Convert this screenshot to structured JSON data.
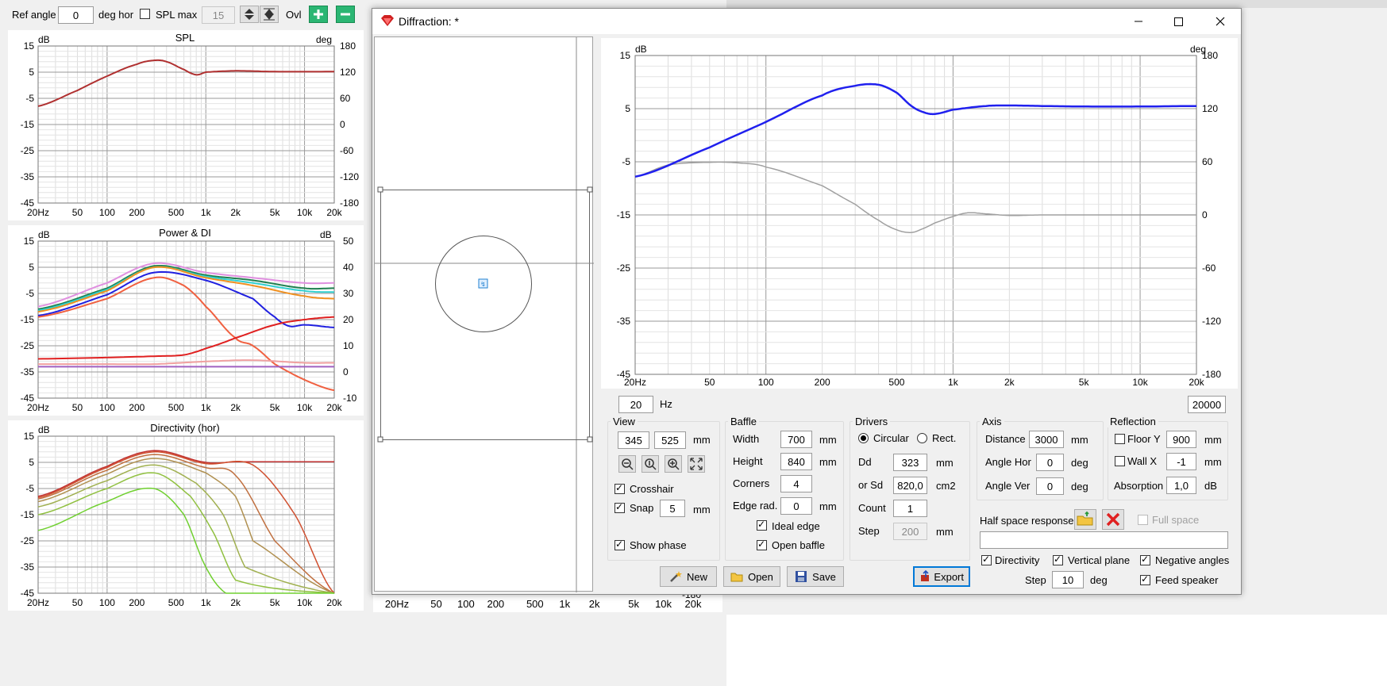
{
  "toolbar": {
    "ref_angle_label": "Ref angle",
    "ref_angle_value": "0",
    "deg_hor_label": "deg hor",
    "spl_max_label": "SPL max",
    "spl_max_value": "15",
    "ovl_label": "Ovl"
  },
  "charts": {
    "spl": {
      "title": "SPL",
      "left_unit": "dB",
      "right_unit": "deg",
      "left_ticks": [
        "15",
        "5",
        "-5",
        "-15",
        "-25",
        "-35",
        "-45"
      ],
      "right_ticks": [
        "180",
        "120",
        "60",
        "0",
        "-60",
        "-120",
        "-180"
      ]
    },
    "power": {
      "title": "Power & DI",
      "left_unit": "dB",
      "right_unit": "dB",
      "left_ticks": [
        "15",
        "5",
        "-5",
        "-15",
        "-25",
        "-35",
        "-45"
      ],
      "right_ticks": [
        "50",
        "40",
        "30",
        "20",
        "10",
        "0",
        "-10"
      ]
    },
    "directivity": {
      "title": "Directivity (hor)",
      "left_unit": "dB",
      "left_ticks": [
        "15",
        "5",
        "-5",
        "-15",
        "-25",
        "-35",
        "-45"
      ]
    },
    "x_ticks": [
      "20Hz",
      "50",
      "100",
      "200",
      "500",
      "1k",
      "2k",
      "5k",
      "10k",
      "20k"
    ],
    "bottom_x_ticks": [
      "20Hz",
      "50",
      "100",
      "200",
      "500",
      "1k",
      "2k",
      "5k",
      "10k",
      "20k"
    ],
    "bottom_right_tick": "-180"
  },
  "chart_data": [
    {
      "type": "line",
      "title": "SPL",
      "x_scale": "log",
      "xlim": [
        20,
        20000
      ],
      "ylim": [
        -45,
        15
      ],
      "y2lim": [
        -180,
        180
      ],
      "series": [
        {
          "color": "#b03030",
          "x": [
            20,
            50,
            100,
            200,
            300,
            400,
            600,
            800,
            1000,
            2000,
            5000,
            20000
          ],
          "y": [
            -8,
            -2,
            3.5,
            8,
            9.5,
            9,
            6,
            4,
            5,
            5.5,
            5.2,
            5.2
          ]
        }
      ]
    },
    {
      "type": "line",
      "title": "Power & DI",
      "x_scale": "log",
      "xlim": [
        20,
        20000
      ],
      "ylim": [
        -45,
        15
      ],
      "y2lim": [
        -10,
        50
      ],
      "series": [
        {
          "color": "#e090e0",
          "x": [
            20,
            100,
            300,
            1000,
            3000,
            10000,
            20000
          ],
          "y": [
            -10,
            -1,
            6.5,
            3,
            1,
            -1,
            -1
          ]
        },
        {
          "color": "#208050",
          "x": [
            20,
            100,
            300,
            1000,
            3000,
            10000,
            20000
          ],
          "y": [
            -11,
            -3,
            5.5,
            2,
            0,
            -3,
            -3
          ]
        },
        {
          "color": "#30d0d0",
          "x": [
            20,
            100,
            300,
            1000,
            3000,
            10000,
            20000
          ],
          "y": [
            -11.5,
            -3.5,
            5,
            1.5,
            -1,
            -4,
            -4.5
          ]
        },
        {
          "color": "#f09020",
          "x": [
            20,
            100,
            300,
            1000,
            3000,
            10000,
            20000
          ],
          "y": [
            -12,
            -4,
            5,
            1,
            -2,
            -6,
            -7
          ]
        },
        {
          "color": "#2020e0",
          "x": [
            20,
            100,
            300,
            1000,
            3000,
            5000,
            7000,
            10000,
            20000
          ],
          "y": [
            -13.5,
            -5.5,
            3,
            0,
            -7,
            -14,
            -17.5,
            -17,
            -18
          ]
        },
        {
          "color": "#f06040",
          "x": [
            20,
            100,
            300,
            600,
            1000,
            2000,
            3000,
            5000,
            10000,
            20000
          ],
          "y": [
            -14,
            -7,
            1,
            -2,
            -10,
            -22,
            -25,
            -32,
            -38,
            -42
          ]
        },
        {
          "color": "#e02020",
          "x": [
            20,
            100,
            300,
            600,
            1000,
            2000,
            5000,
            10000,
            20000
          ],
          "y": [
            -30,
            -29.5,
            -29,
            -28.5,
            -26,
            -22,
            -17,
            -15,
            -14
          ]
        },
        {
          "color": "#f0a0a0",
          "x": [
            20,
            100,
            300,
            1000,
            3000,
            10000,
            20000
          ],
          "y": [
            -32,
            -32,
            -32,
            -31,
            -30.5,
            -31.5,
            -31.5
          ]
        },
        {
          "color": "#a060c0",
          "x": [
            20,
            100,
            300,
            1000,
            3000,
            10000,
            20000
          ],
          "y": [
            -33,
            -33,
            -33,
            -33,
            -33,
            -33,
            -33
          ]
        }
      ]
    },
    {
      "type": "line",
      "title": "Directivity (hor)",
      "x_scale": "log",
      "xlim": [
        20,
        20000
      ],
      "ylim": [
        -45,
        15
      ],
      "series": [
        {
          "color": "#c03030",
          "x": [
            20,
            100,
            300,
            1000,
            2000,
            20000
          ],
          "y": [
            -8,
            3.5,
            9.5,
            5,
            5.2,
            5.2
          ]
        },
        {
          "color": "#d05030",
          "x": [
            20,
            100,
            300,
            1000,
            3000,
            8000,
            20000
          ],
          "y": [
            -8.5,
            3,
            9,
            4.5,
            4,
            -15,
            -45
          ]
        },
        {
          "color": "#c07040",
          "x": [
            20,
            100,
            300,
            1000,
            2000,
            5000,
            20000
          ],
          "y": [
            -9,
            2,
            8,
            3,
            0,
            -25,
            -45
          ]
        },
        {
          "color": "#b09050",
          "x": [
            20,
            100,
            300,
            1000,
            2000,
            3000,
            20000
          ],
          "y": [
            -10,
            0.5,
            6.5,
            1,
            -8,
            -25,
            -45
          ]
        },
        {
          "color": "#a0b050",
          "x": [
            20,
            100,
            300,
            800,
            1500,
            2500,
            20000
          ],
          "y": [
            -12,
            -2,
            4,
            -3,
            -15,
            -35,
            -45
          ]
        },
        {
          "color": "#90c040",
          "x": [
            20,
            100,
            300,
            700,
            1200,
            2000,
            20000
          ],
          "y": [
            -15,
            -5,
            1,
            -8,
            -22,
            -40,
            -45
          ]
        },
        {
          "color": "#70d030",
          "x": [
            20,
            100,
            300,
            600,
            1000,
            1600,
            20000
          ],
          "y": [
            -21,
            -10,
            -5,
            -15,
            -35,
            -45,
            -45
          ]
        }
      ]
    },
    {
      "type": "line",
      "title": "Diffraction",
      "x_scale": "log",
      "xlim": [
        20,
        20000
      ],
      "ylim": [
        -45,
        15
      ],
      "y2lim": [
        -180,
        180
      ],
      "series": [
        {
          "color": "#2020ee",
          "x": [
            20,
            50,
            100,
            200,
            300,
            400,
            500,
            600,
            700,
            800,
            1000,
            1500,
            2000,
            3000,
            5000,
            10000,
            20000
          ],
          "y": [
            -7.8,
            -2.3,
            2.5,
            7.5,
            9.3,
            9.5,
            8,
            5.5,
            4.3,
            4,
            4.8,
            5.5,
            5.6,
            5.5,
            5.4,
            5.4,
            5.5
          ]
        },
        {
          "color": "#a0a0a0",
          "x": [
            20,
            30,
            50,
            70,
            100,
            200,
            300,
            400,
            500,
            600,
            700,
            800,
            1000,
            1200,
            1500,
            2000,
            3000,
            5000,
            10000,
            20000
          ],
          "y": [
            -7.8,
            -5.6,
            -5.1,
            -5.2,
            -6,
            -9.5,
            -13,
            -16,
            -17.8,
            -18.3,
            -17.5,
            -16.5,
            -15.3,
            -14.6,
            -14.8,
            -15.1,
            -15,
            -15,
            -15,
            -15
          ]
        }
      ]
    }
  ],
  "diffraction": {
    "title": "Diffraction: *",
    "left_unit": "dB",
    "right_unit": "deg",
    "left_ticks": [
      "15",
      "5",
      "-5",
      "-15",
      "-25",
      "-35",
      "-45"
    ],
    "right_ticks": [
      "180",
      "120",
      "60",
      "0",
      "-60",
      "-120",
      "-180"
    ],
    "x_ticks": [
      "20Hz",
      "50",
      "100",
      "200",
      "500",
      "1k",
      "2k",
      "5k",
      "10k",
      "20k"
    ],
    "freq_min": "20",
    "freq_unit": "Hz",
    "freq_max": "20000",
    "view": {
      "title": "View",
      "w": "345",
      "h": "525",
      "unit": "mm",
      "crosshair_label": "Crosshair",
      "snap_label": "Snap",
      "snap_value": "5",
      "snap_unit": "mm",
      "show_phase_label": "Show phase"
    },
    "baffle": {
      "title": "Baffle",
      "width_label": "Width",
      "width": "700",
      "height_label": "Height",
      "height": "840",
      "corners_label": "Corners",
      "corners": "4",
      "edge_label": "Edge rad.",
      "edge": "0",
      "unit": "mm",
      "ideal_edge_label": "Ideal edge",
      "open_baffle_label": "Open baffle"
    },
    "drivers": {
      "title": "Drivers",
      "circular_label": "Circular",
      "rect_label": "Rect.",
      "dd_label": "Dd",
      "dd": "323",
      "dd_unit": "mm",
      "sd_label": "or Sd",
      "sd": "820,0",
      "sd_unit": "cm2",
      "count_label": "Count",
      "count": "1",
      "step_label": "Step",
      "step": "200",
      "step_unit": "mm"
    },
    "axis": {
      "title": "Axis",
      "distance_label": "Distance",
      "distance": "3000",
      "distance_unit": "mm",
      "angle_hor_label": "Angle Hor",
      "angle_hor": "0",
      "angle_ver_label": "Angle Ver",
      "angle_ver": "0",
      "deg": "deg"
    },
    "reflection": {
      "title": "Reflection",
      "floor_label": "Floor Y",
      "floor": "900",
      "wall_label": "Wall  X",
      "wall": "-1",
      "unit": "mm",
      "absorption_label": "Absorption",
      "absorption": "1,0",
      "absorption_unit": "dB"
    },
    "half_space_label": "Half space response",
    "full_space_label": "Full space",
    "directivity_label": "Directivity",
    "vertical_plane_label": "Vertical plane",
    "negative_angles_label": "Negative angles",
    "feed_speaker_label": "Feed speaker",
    "step_label": "Step",
    "step_value": "10",
    "step_unit": "deg",
    "buttons": {
      "new": "New",
      "open": "Open",
      "save": "Save",
      "export": "Export"
    }
  }
}
